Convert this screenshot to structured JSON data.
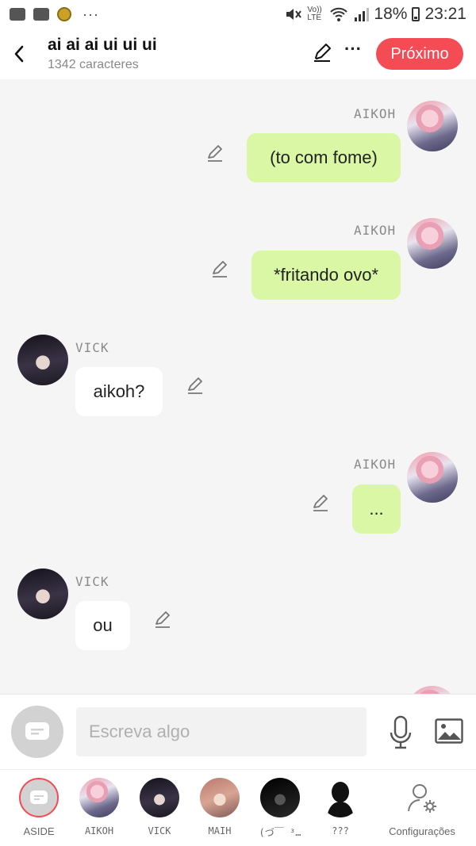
{
  "status_bar": {
    "volte": "Vo)) LTE",
    "battery": "18%",
    "time": "23:21",
    "dots": "···"
  },
  "header": {
    "title": "ai ai ai ui ui ui",
    "subtitle": "1342 caracteres",
    "more": "···",
    "next_label": "Próximo"
  },
  "messages": [
    {
      "side": "right",
      "name": "AIKOH",
      "text": "(to com fome)"
    },
    {
      "side": "right",
      "name": "AIKOH",
      "text": "*fritando ovo*"
    },
    {
      "side": "left",
      "name": "VICK",
      "text": "aikoh?"
    },
    {
      "side": "right",
      "name": "AIKOH",
      "text": "..."
    },
    {
      "side": "left",
      "name": "VICK",
      "text": "ou"
    }
  ],
  "composer": {
    "placeholder": "Escreva algo"
  },
  "characters": [
    {
      "label": "ASIDE"
    },
    {
      "label": "AIKOH"
    },
    {
      "label": "VICK"
    },
    {
      "label": "MAIH"
    },
    {
      "label": "(づ￣ ³…"
    },
    {
      "label": "???"
    },
    {
      "label": "Configurações"
    }
  ],
  "colors": {
    "accent": "#f44b55",
    "my_bubble": "#d9f7a4",
    "other_bubble": "#ffffff",
    "background": "#f5f5f5"
  }
}
